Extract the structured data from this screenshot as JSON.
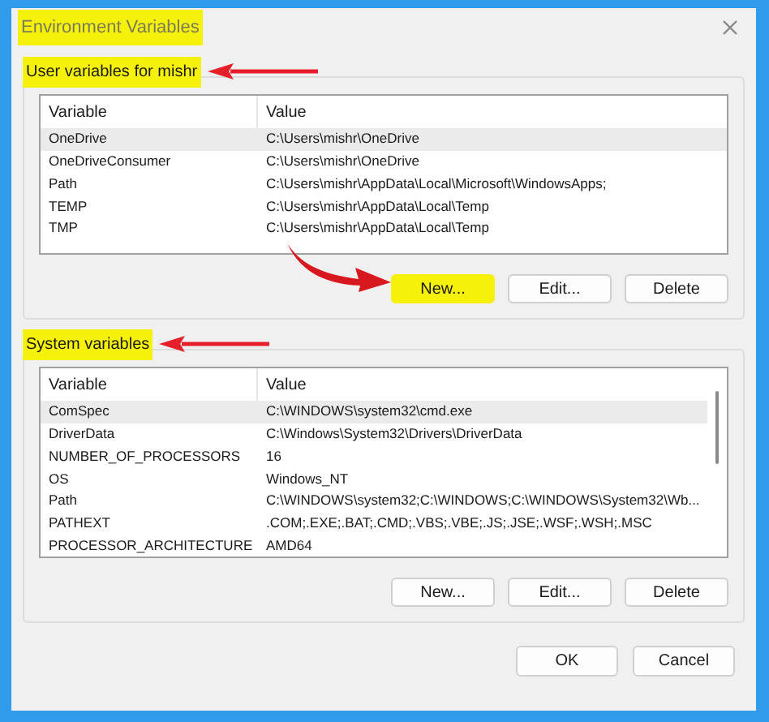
{
  "window": {
    "title": "Environment Variables",
    "highlighted": true
  },
  "groups": [
    {
      "label": "User variables for mishr",
      "highlighted": true,
      "annotation_arrow": true,
      "columns": [
        "Variable",
        "Value"
      ],
      "scrollbar": false,
      "rows": [
        {
          "variable": "OneDrive",
          "value": "C:\\Users\\mishr\\OneDrive",
          "selected": true
        },
        {
          "variable": "OneDriveConsumer",
          "value": "C:\\Users\\mishr\\OneDrive",
          "selected": false
        },
        {
          "variable": "Path",
          "value": "C:\\Users\\mishr\\AppData\\Local\\Microsoft\\WindowsApps;",
          "selected": false
        },
        {
          "variable": "TEMP",
          "value": "C:\\Users\\mishr\\AppData\\Local\\Temp",
          "selected": false
        },
        {
          "variable": "TMP",
          "value": "C:\\Users\\mishr\\AppData\\Local\\Temp",
          "selected": false
        }
      ],
      "buttons": [
        {
          "label": "New...",
          "highlighted": true,
          "annotation_arrow": true
        },
        {
          "label": "Edit...",
          "highlighted": false,
          "annotation_arrow": false
        },
        {
          "label": "Delete",
          "highlighted": false,
          "annotation_arrow": false
        }
      ]
    },
    {
      "label": "System variables",
      "highlighted": true,
      "annotation_arrow": true,
      "columns": [
        "Variable",
        "Value"
      ],
      "scrollbar": true,
      "rows": [
        {
          "variable": "ComSpec",
          "value": "C:\\WINDOWS\\system32\\cmd.exe",
          "selected": true
        },
        {
          "variable": "DriverData",
          "value": "C:\\Windows\\System32\\Drivers\\DriverData",
          "selected": false
        },
        {
          "variable": "NUMBER_OF_PROCESSORS",
          "value": "16",
          "selected": false
        },
        {
          "variable": "OS",
          "value": "Windows_NT",
          "selected": false
        },
        {
          "variable": "Path",
          "value": "C:\\WINDOWS\\system32;C:\\WINDOWS;C:\\WINDOWS\\System32\\Wb...",
          "selected": false
        },
        {
          "variable": "PATHEXT",
          "value": ".COM;.EXE;.BAT;.CMD;.VBS;.VBE;.JS;.JSE;.WSF;.WSH;.MSC",
          "selected": false
        },
        {
          "variable": "PROCESSOR_ARCHITECTURE",
          "value": "AMD64",
          "selected": false
        }
      ],
      "buttons": [
        {
          "label": "New...",
          "highlighted": false,
          "annotation_arrow": false
        },
        {
          "label": "Edit...",
          "highlighted": false,
          "annotation_arrow": false
        },
        {
          "label": "Delete",
          "highlighted": false,
          "annotation_arrow": false
        }
      ]
    }
  ],
  "dialog_buttons": [
    "OK",
    "Cancel"
  ]
}
